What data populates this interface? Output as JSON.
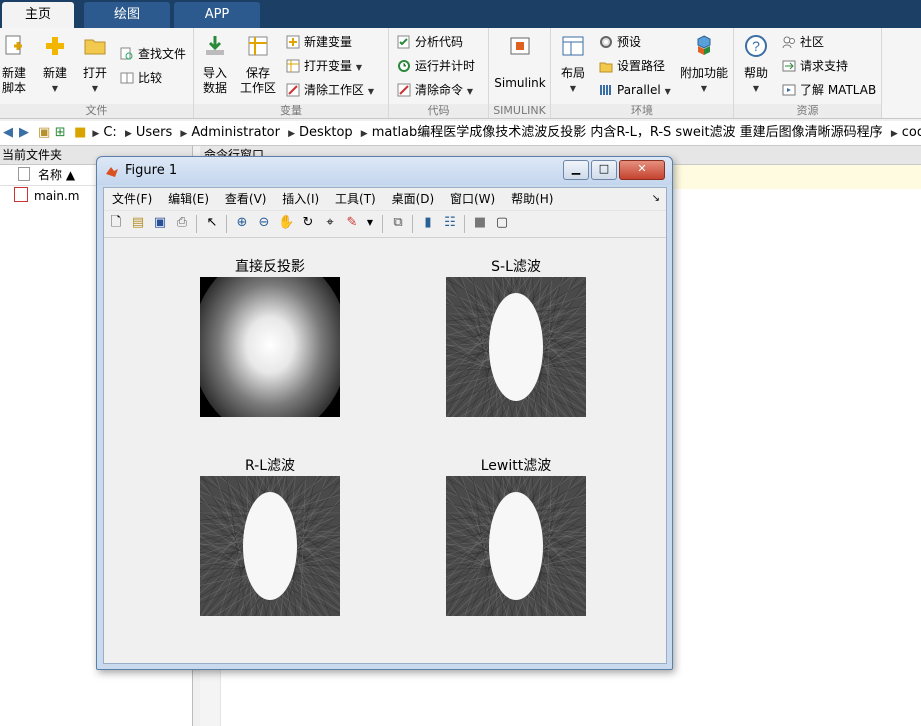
{
  "tabs": [
    {
      "label": "主页",
      "active": true
    },
    {
      "label": "绘图",
      "active": false
    },
    {
      "label": "APP",
      "active": false
    }
  ],
  "ribbon": {
    "file_group": {
      "label": "文件",
      "new_script": "新建\n脚本",
      "new": "新建",
      "open": "打开",
      "find_files": "查找文件",
      "compare": "比较"
    },
    "variable_group": {
      "label": "变量",
      "import_data": "导入\n数据",
      "save_workspace": "保存\n工作区",
      "new_variable": "新建变量",
      "open_variable": "打开变量",
      "clear_workspace": "清除工作区"
    },
    "code_group": {
      "label": "代码",
      "analyze_code": "分析代码",
      "run_and_time": "运行并计时",
      "clear_commands": "清除命令"
    },
    "simulink_group": {
      "label": "SIMULINK",
      "simulink": "Simulink"
    },
    "environment_group": {
      "label": "环境",
      "layout": "布局",
      "preferences": "预设",
      "set_path": "设置路径",
      "parallel": "Parallel",
      "add_ons": "附加功能"
    },
    "resources_group": {
      "label": "资源",
      "help": "帮助",
      "community": "社区",
      "request_support": "请求支持",
      "learn_matlab": "了解 MATLAB"
    }
  },
  "address": {
    "crumbs": [
      "C:",
      "Users",
      "Administrator",
      "Desktop",
      "matlab编程医学成像技术滤波反投影 内含R-L，R-S sweit滤波 重建后图像清晰源码程序",
      "code"
    ]
  },
  "current_folder": {
    "title": "当前文件夹",
    "column_name": "名称 ▲",
    "files": [
      "main.m"
    ]
  },
  "command_window": {
    "title": "命令行窗口"
  },
  "figure": {
    "title": "Figure 1",
    "menu": [
      "文件(F)",
      "编辑(E)",
      "查看(V)",
      "插入(I)",
      "工具(T)",
      "桌面(D)",
      "窗口(W)",
      "帮助(H)"
    ],
    "subplots": [
      {
        "title": "直接反投影",
        "kind": "blur"
      },
      {
        "title": "S-L滤波",
        "kind": "filtered"
      },
      {
        "title": "R-L滤波",
        "kind": "filtered"
      },
      {
        "title": "Lewitt滤波",
        "kind": "filtered"
      }
    ]
  },
  "colors": {
    "tabbar": "#1c3f66",
    "tab_inactive": "#2c5a8e",
    "figure_frame": "#c9d9ee"
  }
}
